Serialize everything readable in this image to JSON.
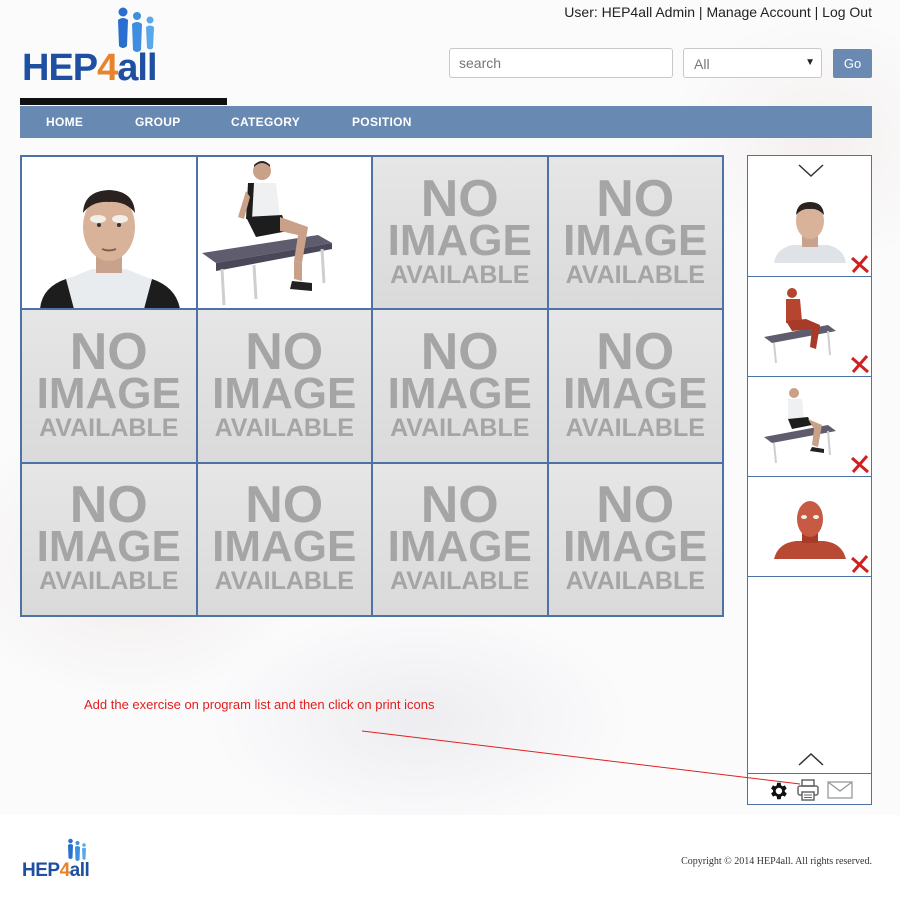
{
  "header": {
    "user_label": "User:",
    "user_name": "HEP4all Admin",
    "separator": "|",
    "manage_account": "Manage Account",
    "log_out": "Log Out",
    "logo": {
      "hep": "HEP",
      "four": "4",
      "all": "all"
    }
  },
  "search": {
    "placeholder": "search",
    "filter_value": "All",
    "go_label": "Go"
  },
  "nav": {
    "items": [
      {
        "label": "HOME"
      },
      {
        "label": "GROUP"
      },
      {
        "label": "CATEGORY"
      },
      {
        "label": "POSITION"
      }
    ]
  },
  "gallery": {
    "no_image": {
      "line1": "NO",
      "line2": "IMAGE",
      "line3": "AVAILABLE"
    },
    "cells": [
      {
        "type": "face-image"
      },
      {
        "type": "seated-table-image"
      },
      {
        "type": "no-image"
      },
      {
        "type": "no-image"
      },
      {
        "type": "no-image"
      },
      {
        "type": "no-image"
      },
      {
        "type": "no-image"
      },
      {
        "type": "no-image"
      },
      {
        "type": "no-image"
      },
      {
        "type": "no-image"
      },
      {
        "type": "no-image"
      },
      {
        "type": "no-image"
      }
    ]
  },
  "program_list": {
    "items": [
      {
        "type": "face-image"
      },
      {
        "type": "muscle-seated-image"
      },
      {
        "type": "seated-table-image"
      },
      {
        "type": "muscle-face-image"
      }
    ],
    "icons": [
      "chevron-down-icon",
      "chevron-up-icon",
      "gear-icon",
      "printer-icon",
      "mail-icon",
      "remove-icon"
    ]
  },
  "annotation": {
    "text": "Add the exercise on program list and then click on print icons",
    "color": "#e02020"
  },
  "footer": {
    "logo": {
      "hep": "HEP",
      "four": "4",
      "all": "all"
    },
    "copyright": "Copyright © 2014 HEP4all. All rights reserved."
  },
  "colors": {
    "nav_bg": "#6789b2",
    "border": "#4d72a6",
    "brand_blue": "#1f4fa0",
    "brand_orange": "#e8822b"
  }
}
